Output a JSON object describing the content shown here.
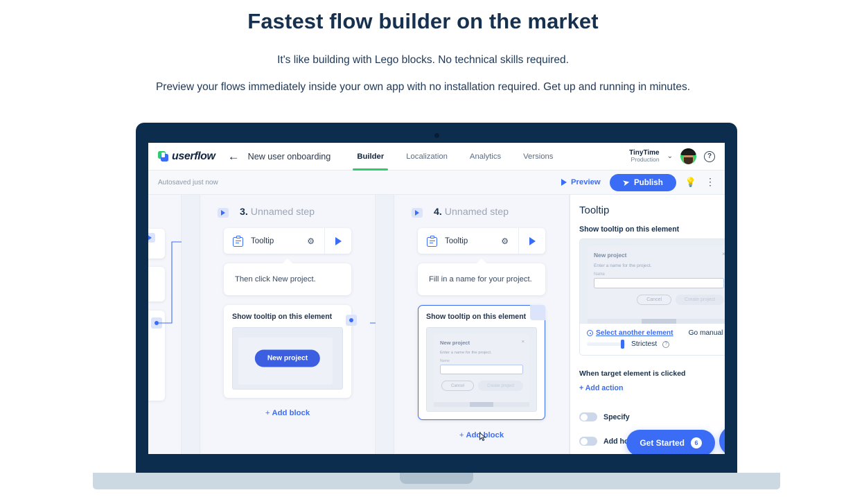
{
  "hero": {
    "title": "Fastest flow builder on the market",
    "subtitle1": "It's like building with Lego blocks. No technical skills required.",
    "subtitle2": "Preview your flows immediately inside your own app with no installation required. Get up and running in minutes."
  },
  "app": {
    "brand": "userflow",
    "back_arrow": "←",
    "doc_title": "New user onboarding",
    "tabs": [
      {
        "label": "Builder",
        "active": true
      },
      {
        "label": "Localization",
        "active": false
      },
      {
        "label": "Analytics",
        "active": false
      },
      {
        "label": "Versions",
        "active": false
      }
    ],
    "workspace": {
      "name": "TinyTime",
      "environment": "Production",
      "chevron": "⌄"
    },
    "help": "?"
  },
  "toolbar": {
    "autosave": "Autosaved just now",
    "preview_label": "Preview",
    "publish_label": "Publish",
    "bulb_icon": "○",
    "kebab_icon": "⋮"
  },
  "canvas": {
    "steps": [
      {
        "number": "3.",
        "name": "Unnamed step",
        "block_type": "Tooltip",
        "tooltip_text": "Then click New project.",
        "element_label": "Show tooltip on this element",
        "preview_kind": "button",
        "preview_button_label": "New project",
        "selected": false,
        "add_block_label": "Add block"
      },
      {
        "number": "4.",
        "name": "Unnamed step",
        "block_type": "Tooltip",
        "tooltip_text": "Fill in a name for your project.",
        "element_label": "Show tooltip on this element",
        "preview_kind": "modal",
        "selected": true,
        "add_block_label": "Add block"
      }
    ],
    "modal_preview": {
      "title": "New project",
      "close": "×",
      "description": "Enter a name for the project.",
      "field_label": "Name",
      "field_value": "",
      "cancel_label": "Cancel",
      "submit_label": "Create project"
    }
  },
  "right_panel": {
    "title": "Tooltip",
    "close": "×",
    "element_section_label": "Show tooltip on this element",
    "select_another_label": "Select another element",
    "go_manual_label": "Go manual",
    "pencil_icon": "✎",
    "strictness_label": "Strictest",
    "strictness_help": "?",
    "trigger_section_label": "When target element is clicked",
    "add_action_label": "+  Add action",
    "toggles": [
      {
        "label": "Specify",
        "on": false
      },
      {
        "label": "Add hotspot",
        "on": false
      }
    ]
  },
  "widgets": {
    "get_started_label": "Get Started",
    "get_started_count": "6",
    "chat_icon": "chat-bubble"
  },
  "colors": {
    "brand_blue": "#3b6cf6",
    "brand_green": "#2ecc71",
    "navy": "#0c2d4d",
    "heading": "#16314f",
    "canvas_bg": "#f4f6fb"
  }
}
